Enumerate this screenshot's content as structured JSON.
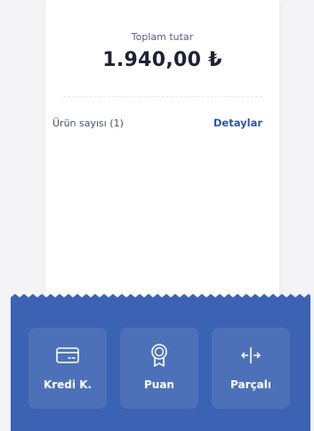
{
  "summary": {
    "total_label": "Toplam tutar",
    "total_amount": "1.940,00 ₺",
    "item_count_label": "Ürün sayısı (1)",
    "details_link": "Detaylar"
  },
  "payment_methods": [
    {
      "label": "Kredi K.",
      "icon": "credit-card-icon"
    },
    {
      "label": "Puan",
      "icon": "award-badge-icon"
    },
    {
      "label": "Parçalı",
      "icon": "split-arrows-icon"
    }
  ],
  "colors": {
    "panel": "#3c63b3",
    "accent_link": "#2f56a6",
    "card": "#ffffff",
    "background": "#f4f4f6"
  }
}
